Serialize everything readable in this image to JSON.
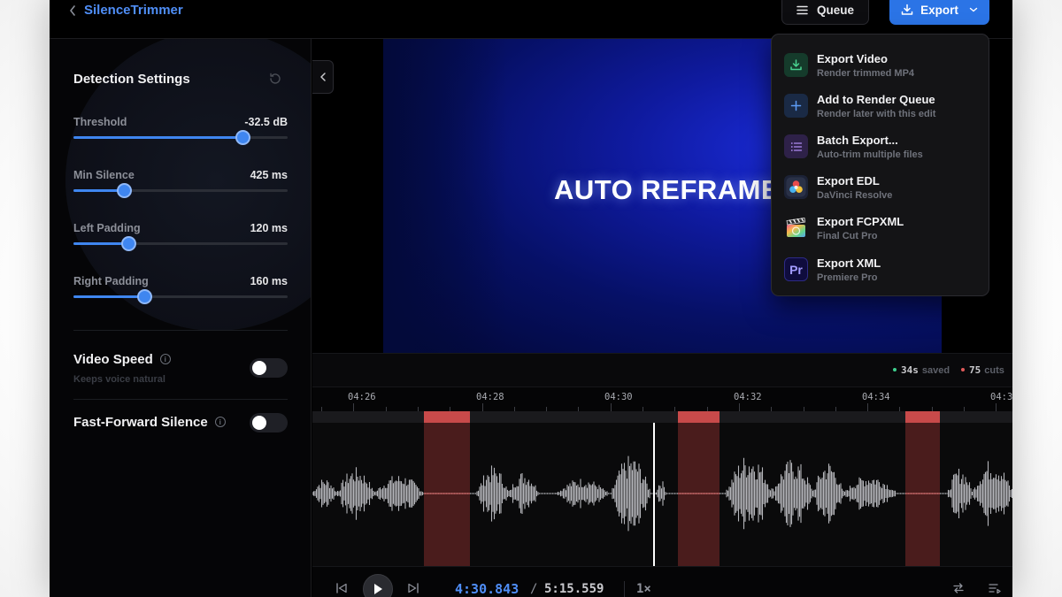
{
  "app": {
    "title": "SilenceTrimmer"
  },
  "header": {
    "queue_label": "Queue",
    "export_label": "Export"
  },
  "detection": {
    "title": "Detection Settings",
    "sliders": [
      {
        "label": "Threshold",
        "value": "-32.5 dB",
        "fraction": 0.79
      },
      {
        "label": "Min Silence",
        "value": "425 ms",
        "fraction": 0.235
      },
      {
        "label": "Left Padding",
        "value": "120 ms",
        "fraction": 0.255
      },
      {
        "label": "Right Padding",
        "value": "160 ms",
        "fraction": 0.33
      }
    ]
  },
  "toggles": {
    "video_speed": {
      "label": "Video Speed",
      "sub": "Keeps voice natural",
      "on": false
    },
    "fast_forward": {
      "label": "Fast-Forward Silence",
      "on": false
    }
  },
  "video": {
    "overlay_text": "AUTO REFRAME"
  },
  "stats": {
    "saved_value": "34s",
    "saved_label": "saved",
    "saved_color": "#3ecf8e",
    "cuts_value": "75",
    "cuts_label": "cuts",
    "cuts_color": "#e05a5a"
  },
  "timeline": {
    "ticks": [
      "04:26",
      "04:28",
      "04:30",
      "04:32",
      "04:34",
      "04:3"
    ]
  },
  "transport": {
    "current": "4:30.843",
    "separator": "/",
    "duration": "5:15.559",
    "speed": "1×"
  },
  "export_menu": {
    "items": [
      {
        "title": "Export Video",
        "sub": "Render trimmed MP4",
        "icon": "download-icon"
      },
      {
        "title": "Add to Render Queue",
        "sub": "Render later with this edit",
        "icon": "plus-icon"
      },
      {
        "title": "Batch Export...",
        "sub": "Auto-trim multiple files",
        "icon": "list-icon"
      },
      {
        "title": "Export EDL",
        "sub": "DaVinci Resolve",
        "icon": "davinci-resolve-icon"
      },
      {
        "title": "Export FCPXML",
        "sub": "Final Cut Pro",
        "icon": "final-cut-pro-icon"
      },
      {
        "title": "Export XML",
        "sub": "Premiere Pro",
        "icon": "premiere-pro-icon"
      }
    ]
  },
  "colors": {
    "accent": "#2b74e6",
    "cut": "#c84a4a"
  }
}
